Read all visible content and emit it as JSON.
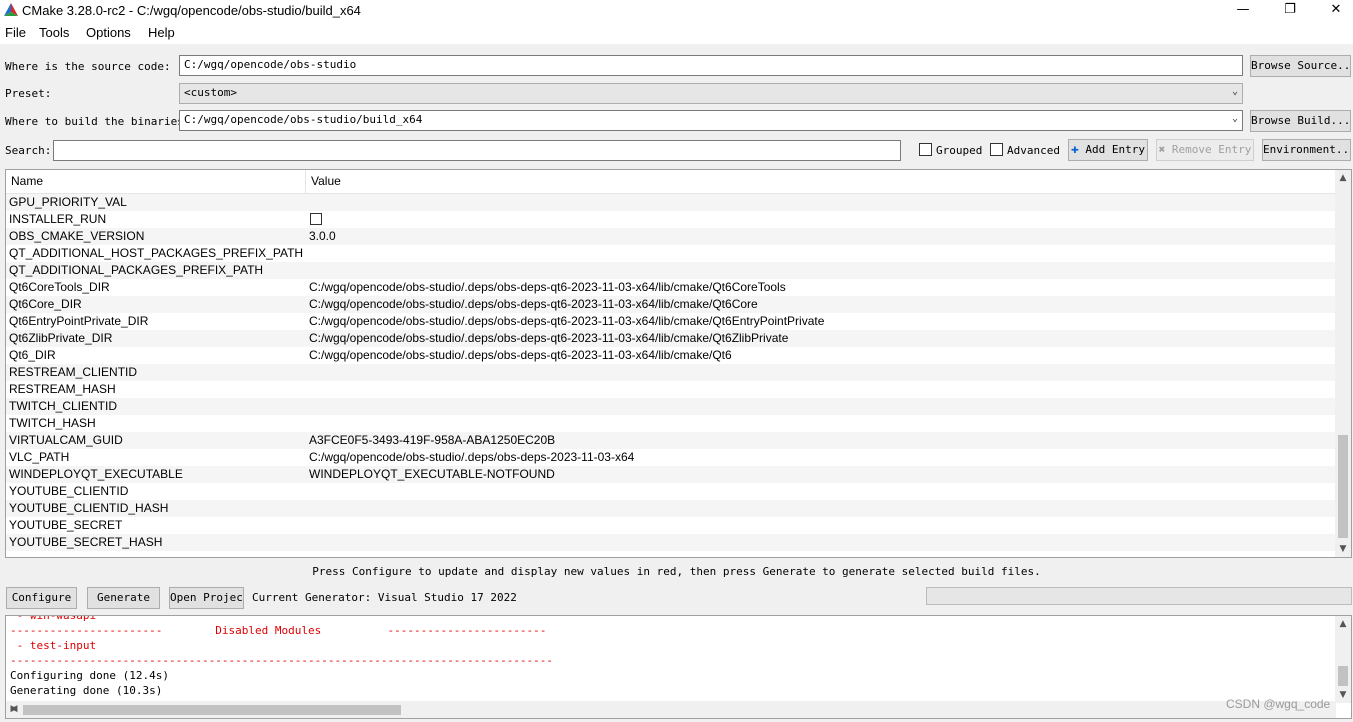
{
  "window": {
    "title": "CMake 3.28.0-rc2 - C:/wgq/opencode/obs-studio/build_x64",
    "minimize": "—",
    "maximize": "❐",
    "close": "✕"
  },
  "menu": [
    "File",
    "Tools",
    "Options",
    "Help"
  ],
  "source": {
    "label": "Where is the source code:",
    "value": "C:/wgq/opencode/obs-studio",
    "browse": "Browse Source..."
  },
  "preset": {
    "label": "Preset:",
    "value": "<custom>"
  },
  "build": {
    "label": "Where to build the binaries:",
    "value": "C:/wgq/opencode/obs-studio/build_x64",
    "browse": "Browse Build..."
  },
  "search": {
    "label": "Search:",
    "value": ""
  },
  "options": {
    "grouped": "Grouped",
    "advanced": "Advanced",
    "add_entry": "Add Entry",
    "remove_entry": "Remove Entry",
    "environment": "Environment..."
  },
  "table": {
    "headers": [
      "Name",
      "Value"
    ],
    "rows": [
      {
        "name": "GPU_PRIORITY_VAL",
        "value": ""
      },
      {
        "name": "INSTALLER_RUN",
        "value": "",
        "checkbox": true
      },
      {
        "name": "OBS_CMAKE_VERSION",
        "value": "3.0.0"
      },
      {
        "name": "QT_ADDITIONAL_HOST_PACKAGES_PREFIX_PATH",
        "value": ""
      },
      {
        "name": "QT_ADDITIONAL_PACKAGES_PREFIX_PATH",
        "value": ""
      },
      {
        "name": "Qt6CoreTools_DIR",
        "value": "C:/wgq/opencode/obs-studio/.deps/obs-deps-qt6-2023-11-03-x64/lib/cmake/Qt6CoreTools"
      },
      {
        "name": "Qt6Core_DIR",
        "value": "C:/wgq/opencode/obs-studio/.deps/obs-deps-qt6-2023-11-03-x64/lib/cmake/Qt6Core"
      },
      {
        "name": "Qt6EntryPointPrivate_DIR",
        "value": "C:/wgq/opencode/obs-studio/.deps/obs-deps-qt6-2023-11-03-x64/lib/cmake/Qt6EntryPointPrivate"
      },
      {
        "name": "Qt6ZlibPrivate_DIR",
        "value": "C:/wgq/opencode/obs-studio/.deps/obs-deps-qt6-2023-11-03-x64/lib/cmake/Qt6ZlibPrivate"
      },
      {
        "name": "Qt6_DIR",
        "value": "C:/wgq/opencode/obs-studio/.deps/obs-deps-qt6-2023-11-03-x64/lib/cmake/Qt6"
      },
      {
        "name": "RESTREAM_CLIENTID",
        "value": ""
      },
      {
        "name": "RESTREAM_HASH",
        "value": ""
      },
      {
        "name": "TWITCH_CLIENTID",
        "value": ""
      },
      {
        "name": "TWITCH_HASH",
        "value": ""
      },
      {
        "name": "VIRTUALCAM_GUID",
        "value": "A3FCE0F5-3493-419F-958A-ABA1250EC20B"
      },
      {
        "name": "VLC_PATH",
        "value": "C:/wgq/opencode/obs-studio/.deps/obs-deps-2023-11-03-x64"
      },
      {
        "name": "WINDEPLOYQT_EXECUTABLE",
        "value": "WINDEPLOYQT_EXECUTABLE-NOTFOUND"
      },
      {
        "name": "YOUTUBE_CLIENTID",
        "value": ""
      },
      {
        "name": "YOUTUBE_CLIENTID_HASH",
        "value": ""
      },
      {
        "name": "YOUTUBE_SECRET",
        "value": ""
      },
      {
        "name": "YOUTUBE_SECRET_HASH",
        "value": ""
      }
    ]
  },
  "hint": "Press Configure to update and display new values in red, then press Generate to generate selected build files.",
  "actions": {
    "configure": "Configure",
    "generate": "Generate",
    "open_project": "Open Project",
    "generator": "Current Generator: Visual Studio 17 2022"
  },
  "output": {
    "lines": [
      {
        "text": " - win-wasapi",
        "red": true
      },
      {
        "text": "-----------------------        Disabled Modules          ------------------------",
        "red": true
      },
      {
        "text": " - test-input",
        "red": true
      },
      {
        "text": "----------------------------------------------------------------------------------",
        "red": true
      },
      {
        "text": "Configuring done (12.4s)",
        "red": false
      },
      {
        "text": "Generating done (10.3s)",
        "red": false
      }
    ]
  },
  "watermark": "CSDN @wgq_code",
  "colors": {
    "accent": "#0a64d8",
    "error_text": "#e00000",
    "window_bg": "#f0f0f0"
  }
}
